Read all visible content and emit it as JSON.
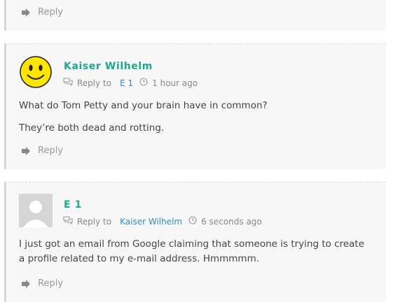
{
  "comments": [
    {
      "reply_label": "Reply"
    },
    {
      "author": "Kaiser Wilhelm",
      "reply_to_label": "Reply to",
      "reply_to_target": "E 1",
      "time": "1 hour ago",
      "paragraphs": [
        "What do Tom Petty and your brain have in common?",
        "They’re both dead and rotting."
      ],
      "reply_label": "Reply",
      "avatar": "smiley-face-avatar"
    },
    {
      "author": "E 1",
      "reply_to_label": "Reply to",
      "reply_to_target": "Kaiser Wilhelm",
      "time": "6 seconds ago",
      "paragraphs": [
        "I just got an email from Google claiming that someone is trying to create a profile related to my e-mail address. Hmmmmm."
      ],
      "reply_label": "Reply",
      "avatar": "default-user-avatar"
    }
  ],
  "colors": {
    "author": "#1aa88e",
    "link": "#2d8fbd",
    "muted": "#999999",
    "text": "#444444",
    "card_bg": "#f7f7f7"
  },
  "icons": {
    "reply": "reply-arrow-icon",
    "reply_to": "speech-bubbles-icon",
    "time": "clock-icon"
  }
}
